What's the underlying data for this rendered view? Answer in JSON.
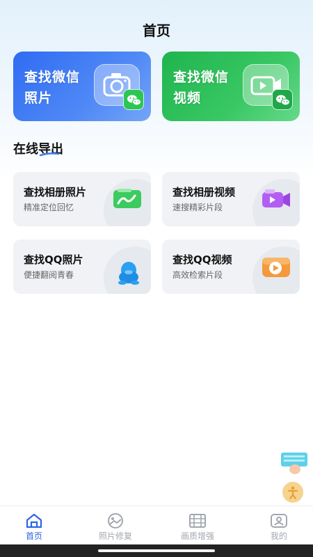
{
  "header": {
    "title": "首页"
  },
  "feature_cards": [
    {
      "line1": "查找微信",
      "line2": "照片"
    },
    {
      "line1": "查找微信",
      "line2": "视频"
    }
  ],
  "section": {
    "title": "在线导出"
  },
  "tiles": [
    {
      "title": "查找相册照片",
      "subtitle": "精准定位回忆",
      "icon": "gallery-photo-icon"
    },
    {
      "title": "查找相册视频",
      "subtitle": "速搜精彩片段",
      "icon": "video-camera-icon"
    },
    {
      "title": "查找QQ照片",
      "subtitle": "便捷翻阅青春",
      "icon": "qq-penguin-icon"
    },
    {
      "title": "查找QQ视频",
      "subtitle": "高效检索片段",
      "icon": "play-video-icon"
    }
  ],
  "tabbar": {
    "items": [
      {
        "label": "首页",
        "icon": "home-icon",
        "active": true
      },
      {
        "label": "照片修复",
        "icon": "photo-icon",
        "active": false
      },
      {
        "label": "画质增强",
        "icon": "film-icon",
        "active": false
      },
      {
        "label": "我的",
        "icon": "profile-icon",
        "active": false
      }
    ]
  },
  "colors": {
    "accent": "#2a66e4",
    "card_blue": "#2f6cf2",
    "card_green": "#1fb44f",
    "tile_bg": "#f0f2f5"
  }
}
